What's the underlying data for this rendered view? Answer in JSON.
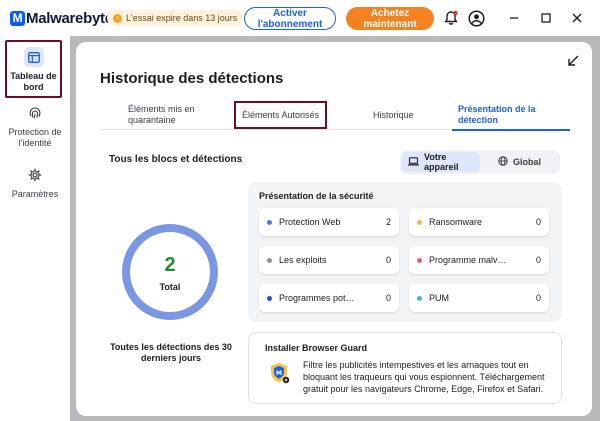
{
  "app": {
    "logo_text": "Malwarebytes",
    "trial_badge": "L'essai expire dans 13 jours",
    "subscribe_label": "Activer l'abonnement",
    "buy_label": "Achetez maintenant",
    "icons": [
      "bell-icon",
      "account-icon",
      "minimize-icon",
      "maximize-icon",
      "close-icon"
    ],
    "colors": {
      "brand_blue": "#1c5fe8",
      "buy_orange": "#f58220",
      "highlight_border": "#6a0f1f",
      "success_green": "#1e8a3a"
    }
  },
  "sidebar": {
    "items": [
      {
        "label": "Tableau de bord",
        "icon": "dashboard-icon",
        "active": true
      },
      {
        "label": "Protection de l'identité",
        "icon": "fingerprint-icon",
        "active": false
      },
      {
        "label": "Paramètres",
        "icon": "gear-icon",
        "active": false
      }
    ]
  },
  "main": {
    "title": "Historique des détections",
    "tabs": [
      {
        "label": "Éléments mis en quarantaine"
      },
      {
        "label": "Éléments Autorisés"
      },
      {
        "label": "Historique"
      },
      {
        "label": "Présentation de la détection"
      }
    ],
    "active_tab": "Présentation de la détection",
    "section_title": "Tous les blocs et détections",
    "toggle": {
      "options": [
        {
          "label": "Votre appareil",
          "icon": "laptop-icon",
          "selected": true
        },
        {
          "label": "Global",
          "icon": "globe-icon",
          "selected": false
        }
      ]
    },
    "ring": {
      "count": "2",
      "label": "Total",
      "caption": "Toutes les détections des 30 derniers jours",
      "color": "#7b96e3"
    },
    "security": {
      "title": "Présentation de la sécurité",
      "items": [
        {
          "name": "Protection Web",
          "count": "2",
          "color": "#4e79e3"
        },
        {
          "name": "Ransomware",
          "count": "0",
          "color": "#f2b64a"
        },
        {
          "name": "Les exploits",
          "count": "0",
          "color": "#8d8f96"
        },
        {
          "name": "Programme malv…",
          "count": "0",
          "color": "#e0607a"
        },
        {
          "name": "Programmes pot…",
          "count": "0",
          "color": "#2350c9"
        },
        {
          "name": "PUM",
          "count": "0",
          "color": "#3fb6d6"
        }
      ]
    },
    "browser_guard": {
      "title": "Installer Browser Guard",
      "text": "Filtre les publicités intempestives et les arnaques tout en bloquant les traqueurs qui vous espionnent. Téléchargement gratuit pour les navigateurs Chrome, Edge, Firefox et Safari.",
      "icon": "browser-guard-icon"
    }
  }
}
